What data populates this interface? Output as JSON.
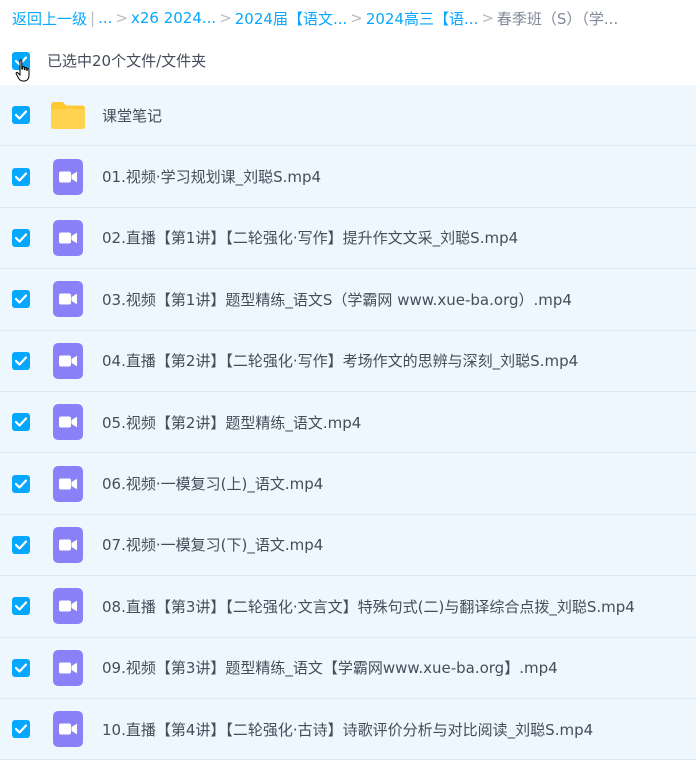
{
  "breadcrumb": {
    "back": "返回上一级",
    "divider": "|",
    "ellipsis": "...",
    "sep": ">",
    "items": [
      "x26 2024...",
      "2024届【语文...",
      "2024高三【语...",
      "春季班（S）（学..."
    ]
  },
  "selection": {
    "label": "已选中20个文件/文件夹"
  },
  "files": [
    {
      "name": "课堂笔记",
      "type": "folder"
    },
    {
      "name": "01.视频·学习规划课_刘聪S.mp4",
      "type": "video"
    },
    {
      "name": "02.直播【第1讲】【二轮强化·写作】提升作文文采_刘聪S.mp4",
      "type": "video"
    },
    {
      "name": "03.视频【第1讲】题型精练_语文S（学霸网 www.xue-ba.org）.mp4",
      "type": "video"
    },
    {
      "name": "04.直播【第2讲】【二轮强化·写作】考场作文的思辨与深刻_刘聪S.mp4",
      "type": "video"
    },
    {
      "name": "05.视频【第2讲】题型精练_语文.mp4",
      "type": "video"
    },
    {
      "name": "06.视频·一模复习(上)_语文.mp4",
      "type": "video"
    },
    {
      "name": "07.视频·一模复习(下)_语文.mp4",
      "type": "video"
    },
    {
      "name": "08.直播【第3讲】【二轮强化·文言文】特殊句式(二)与翻译综合点拨_刘聪S.mp4",
      "type": "video"
    },
    {
      "name": "09.视频【第3讲】题型精练_语文【学霸网www.xue-ba.org】.mp4",
      "type": "video"
    },
    {
      "name": "10.直播【第4讲】【二轮强化·古诗】诗歌评价分析与对比阅读_刘聪S.mp4",
      "type": "video"
    }
  ],
  "colors": {
    "accent": "#06a7ff",
    "row_bg": "#eef7fe",
    "video_icon": "#8a80f8",
    "folder_icon": "#ffc933"
  }
}
